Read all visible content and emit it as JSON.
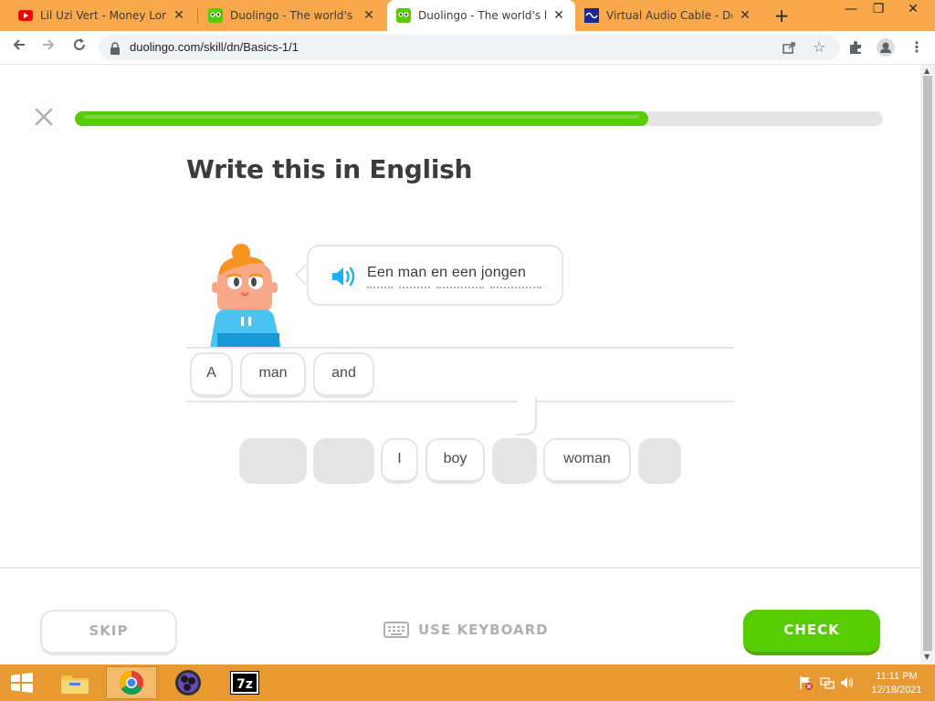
{
  "browser": {
    "tabs": [
      {
        "title": "Lil Uzi Vert - Money Longer",
        "favicon": "youtube-icon",
        "active": false
      },
      {
        "title": "Duolingo - The world's best",
        "favicon": "duolingo-icon",
        "active": false
      },
      {
        "title": "Duolingo - The world's best",
        "favicon": "duolingo-icon",
        "active": true
      },
      {
        "title": "Virtual Audio Cable - Download",
        "favicon": "vac-icon",
        "active": false
      }
    ],
    "new_tab_label": "+",
    "url": "duolingo.com/skill/dn/Basics-1/1"
  },
  "lesson": {
    "progress": 0.71,
    "heading": "Write this in English",
    "prompt_sentence": "Een man en een jongen",
    "answer_tiles": [
      "A",
      "man",
      "and"
    ],
    "word_bank": [
      {
        "label": "",
        "used": true
      },
      {
        "label": "",
        "used": true
      },
      {
        "label": "I",
        "used": false
      },
      {
        "label": "boy",
        "used": false
      },
      {
        "label": "",
        "used": true
      },
      {
        "label": "woman",
        "used": false
      },
      {
        "label": "",
        "used": true
      }
    ]
  },
  "footer": {
    "skip_label": "SKIP",
    "keyboard_label": "USE KEYBOARD",
    "check_label": "CHECK"
  },
  "colors": {
    "accent_green": "#58cc02",
    "tabbar_orange": "#f9a94b",
    "taskbar_orange": "#e69a31"
  },
  "taskbar": {
    "time": "11:11 PM",
    "date": "12/18/2021"
  }
}
